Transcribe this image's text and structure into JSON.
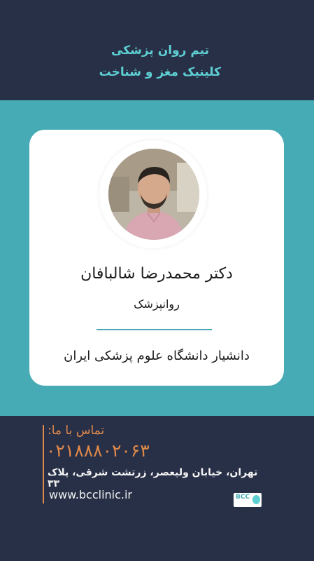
{
  "header": {
    "title": "تیم روان پزشکی",
    "subtitle": "کلینیک مغز و شناخت"
  },
  "card": {
    "name": "دکتر محمدرضا شالبافان",
    "role": "روانپزشک",
    "affiliation": "دانشیار دانشگاه علوم پزشکی ایران"
  },
  "contact": {
    "label": "تماس با ما:",
    "phone": "۰۲۱۸۸۸۰۲۰۶۳",
    "address": "تهران، خیابان ولیعصر، زرتشت شرقی، پلاک ۳۳",
    "website": "www.bcclinic.ir",
    "logo_text": "BCC"
  },
  "colors": {
    "navy": "#283047",
    "teal": "#46abb5",
    "accent_orange": "#e0894a",
    "light_teal_text": "#5ed0d4"
  }
}
